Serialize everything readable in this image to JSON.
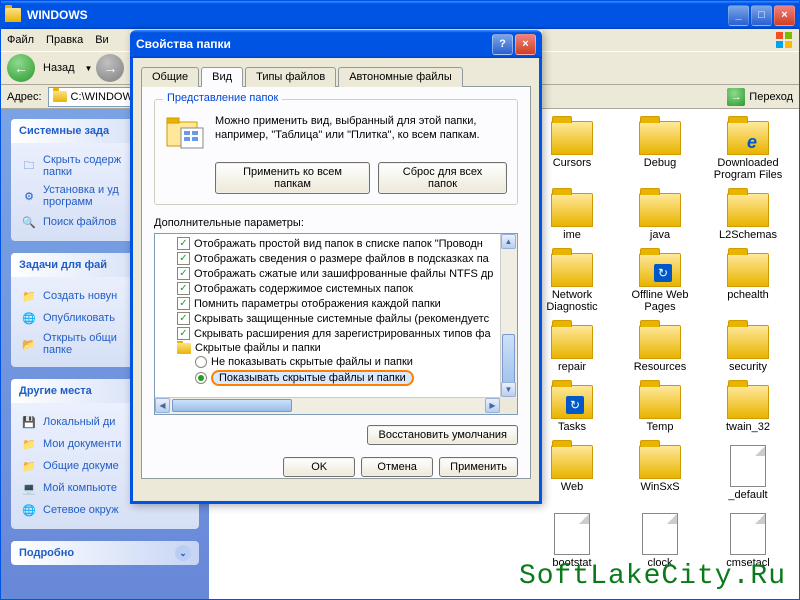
{
  "explorer": {
    "title": "WINDOWS",
    "menu": {
      "file": "Файл",
      "edit": "Правка",
      "view": "Ви"
    },
    "nav_back": "Назад",
    "address_label": "Адрес:",
    "address_value": "C:\\WINDOW",
    "go_label": "Переход"
  },
  "sidebar": {
    "panel1": {
      "title": "Системные зада",
      "items": [
        "Скрыть содерж\nпапки",
        "Установка и уд\nпрограмм",
        "Поиск файлов"
      ]
    },
    "panel2": {
      "title": "Задачи для фай",
      "items": [
        "Создать новун",
        "Опубликовать",
        "Открыть общи\nпапке"
      ]
    },
    "panel3": {
      "title": "Другие места",
      "items": [
        "Локальный ди",
        "Мои документи",
        "Общие докуме",
        "Мой компьюте",
        "Сетевое окруж"
      ]
    },
    "panel4": {
      "title": "Подробно"
    }
  },
  "folders": [
    {
      "label": "Cursors"
    },
    {
      "label": "Debug"
    },
    {
      "label": "Downloaded Program Files",
      "type": "ie"
    },
    {
      "label": "ime"
    },
    {
      "label": "java"
    },
    {
      "label": "L2Schemas"
    },
    {
      "label": "Network Diagnostic"
    },
    {
      "label": "Offline Web Pages",
      "type": "blue"
    },
    {
      "label": "pchealth"
    },
    {
      "label": "repair"
    },
    {
      "label": "Resources"
    },
    {
      "label": "security"
    },
    {
      "label": "Tasks",
      "type": "blue"
    },
    {
      "label": "Temp"
    },
    {
      "label": "twain_32"
    },
    {
      "label": "Web"
    },
    {
      "label": "WinSxS"
    },
    {
      "label": "_default",
      "type": "file"
    },
    {
      "label": "bootstat",
      "type": "file"
    },
    {
      "label": "clock",
      "type": "file"
    },
    {
      "label": "cmsetacl",
      "type": "file"
    }
  ],
  "dialog": {
    "title": "Свойства папки",
    "tabs": {
      "general": "Общие",
      "view": "Вид",
      "types": "Типы файлов",
      "offline": "Автономные файлы"
    },
    "group_title": "Представление папок",
    "group_text": "Можно применить вид, выбранный для этой папки, например, \"Таблица\" или \"Плитка\", ко всем папкам.",
    "apply_all": "Применить ко всем папкам",
    "reset_all": "Сброс для всех папок",
    "extra_label": "Дополнительные параметры:",
    "tree": [
      {
        "type": "check",
        "checked": true,
        "text": "Отображать простой вид папок в списке папок \"Проводн"
      },
      {
        "type": "check",
        "checked": true,
        "text": "Отображать сведения о размере файлов в подсказках па"
      },
      {
        "type": "check",
        "checked": true,
        "text": "Отображать сжатые или зашифрованные файлы NTFS др"
      },
      {
        "type": "check",
        "checked": true,
        "text": "Отображать содержимое системных папок"
      },
      {
        "type": "check",
        "checked": true,
        "text": "Помнить параметры отображения каждой папки"
      },
      {
        "type": "check",
        "checked": true,
        "text": "Скрывать защищенные системные файлы (рекомендуетс"
      },
      {
        "type": "check",
        "checked": true,
        "text": "Скрывать расширения для зарегистрированных типов фа"
      },
      {
        "type": "folder",
        "text": "Скрытые файлы и папки"
      },
      {
        "type": "radio",
        "checked": false,
        "indent": 2,
        "text": "Не показывать скрытые файлы и папки"
      },
      {
        "type": "radio",
        "checked": true,
        "indent": 2,
        "highlight": true,
        "text": "Показывать скрытые файлы и папки"
      }
    ],
    "restore": "Восстановить умолчания",
    "ok": "OK",
    "cancel": "Отмена",
    "apply": "Применить"
  },
  "watermark": "SoftLakeCity.Ru"
}
